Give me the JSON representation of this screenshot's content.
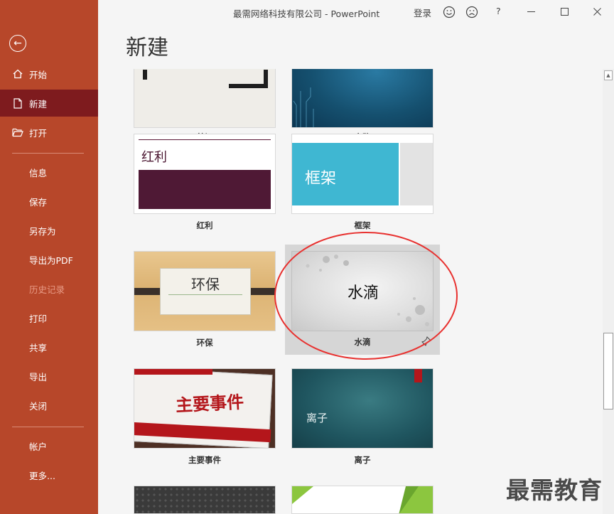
{
  "window": {
    "title": "最需网络科技有限公司  -  PowerPoint",
    "login_label": "登录",
    "help_label": "?"
  },
  "sidebar": {
    "back_icon": "back-arrow-icon",
    "items": [
      {
        "label": "开始",
        "icon": "home-icon"
      },
      {
        "label": "新建",
        "icon": "new-document-icon",
        "active": true
      },
      {
        "label": "打开",
        "icon": "open-folder-icon"
      },
      {
        "label": "信息"
      },
      {
        "label": "保存"
      },
      {
        "label": "另存为"
      },
      {
        "label": "导出为PDF"
      },
      {
        "label": "历史记录",
        "disabled": true
      },
      {
        "label": "打印"
      },
      {
        "label": "共享"
      },
      {
        "label": "导出"
      },
      {
        "label": "关闭"
      },
      {
        "label": "帐户"
      },
      {
        "label": "更多..."
      }
    ]
  },
  "main": {
    "page_title": "新建",
    "templates": [
      {
        "label": "剪切"
      },
      {
        "label": "电路"
      },
      {
        "label": "红利",
        "thumb_text": "红利"
      },
      {
        "label": "框架",
        "thumb_text": "框架"
      },
      {
        "label": "环保",
        "thumb_text": "环保"
      },
      {
        "label": "水滴",
        "thumb_text": "水滴",
        "selected": true,
        "pin_icon": "pin-icon"
      },
      {
        "label": "主要事件",
        "thumb_text": "主要事件"
      },
      {
        "label": "离子",
        "thumb_text": "离子"
      }
    ]
  },
  "watermark": "最需教育",
  "colors": {
    "sidebar_bg": "#b7472a",
    "sidebar_active": "#7e1b1e",
    "highlight_ring": "#e8312f"
  }
}
